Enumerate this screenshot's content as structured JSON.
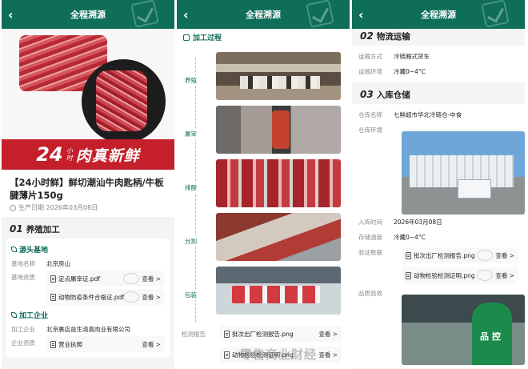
{
  "common": {
    "header_title": "全程溯源"
  },
  "panel1": {
    "banner": {
      "big": "24",
      "small_top": "小",
      "small_bottom": "时",
      "text": "肉真新鲜"
    },
    "product_title": "【24小时鲜】鲜切潮汕牛肉匙柄/牛板腱薄片150g",
    "production_date": "生产日期  2026年03月08日",
    "section": {
      "num": "01",
      "label": "养殖加工"
    },
    "source_base": {
      "heading": "源头基地",
      "name_label": "基地名称",
      "name_value": "北京房山",
      "cert_label": "基地资质",
      "files": [
        {
          "name": "定点屠宰证.pdf",
          "action": "查看 >"
        },
        {
          "name": "动物防疫条件合格证.pdf",
          "action": "查看 >"
        }
      ]
    },
    "processor": {
      "heading": "加工企业",
      "name_label": "加工企业",
      "name_value": "北京裹店益生清真肉业有限公司",
      "cert_label": "企业资质",
      "files": [
        {
          "name": "营业执照",
          "action": "查看 >"
        }
      ]
    }
  },
  "panel2": {
    "heading": "加工过程",
    "steps": [
      "养殖",
      "屠宰",
      "排酸",
      "分割",
      "包装"
    ],
    "report_label": "检测报告",
    "files": [
      {
        "name": "批次出厂检测报告.png",
        "action": "查看 >"
      },
      {
        "name": "动物检验检测证明.png",
        "action": "查看 >"
      }
    ]
  },
  "panel3": {
    "logistics": {
      "num": "02",
      "label": "物流运输",
      "mode_label": "运输方式",
      "mode_value": "冷链厢式货车",
      "env_label": "运输环境",
      "env_value": "冷藏0~4°C"
    },
    "storage": {
      "num": "03",
      "label": "入库仓储",
      "warehouse_label": "仓库名称",
      "warehouse_value": "七鲜超市华北冷链仓-中食",
      "env_label": "仓库环境",
      "in_time_label": "入库时间",
      "in_time_value": "2026年03月08日",
      "temp_label": "存储温度",
      "temp_value": "冷藏0~4°C",
      "inspect_label": "验证数据",
      "files": [
        {
          "name": "批次出厂检测报告.png",
          "action": "查看 >"
        },
        {
          "name": "动物检验检测证明.png",
          "action": "查看 >"
        }
      ],
      "quality_label": "品质验收"
    }
  },
  "watermark": "零售商业财经"
}
